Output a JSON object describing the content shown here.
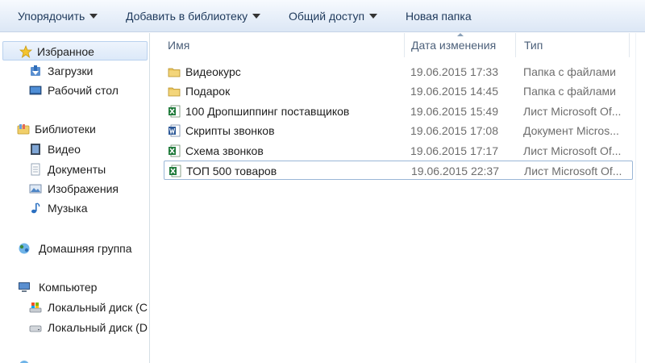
{
  "toolbar": {
    "organize": "Упорядочить",
    "add_to_library": "Добавить в библиотеку",
    "share": "Общий доступ",
    "new_folder": "Новая папка"
  },
  "nav": {
    "favorites": "Избранное",
    "downloads": "Загрузки",
    "desktop": "Рабочий стол",
    "libraries": "Библиотеки",
    "video": "Видео",
    "documents": "Документы",
    "pictures": "Изображения",
    "music": "Музыка",
    "homegroup": "Домашняя группа",
    "computer": "Компьютер",
    "disk_c": "Локальный диск (C",
    "disk_d": "Локальный диск (D"
  },
  "columns": {
    "name": "Имя",
    "date": "Дата изменения",
    "type": "Тип"
  },
  "files": [
    {
      "name": "Видеокурс",
      "date": "19.06.2015 17:33",
      "type": "Папка с файлами",
      "icon": "folder-icon"
    },
    {
      "name": "Подарок",
      "date": "19.06.2015 14:45",
      "type": "Папка с файлами",
      "icon": "folder-icon"
    },
    {
      "name": "100 Дропшиппинг поставщиков",
      "date": "19.06.2015 15:49",
      "type": "Лист Microsoft Of...",
      "icon": "excel-file-icon"
    },
    {
      "name": "Скрипты звонков",
      "date": "19.06.2015 17:08",
      "type": "Документ Micros...",
      "icon": "word-file-icon"
    },
    {
      "name": "Схема звонков",
      "date": "19.06.2015 17:17",
      "type": "Лист Microsoft Of...",
      "icon": "excel-file-icon"
    },
    {
      "name": "ТОП 500 товаров",
      "date": "19.06.2015 22:37",
      "type": "Лист Microsoft Of...",
      "icon": "excel-file-icon"
    }
  ],
  "colors": {
    "toolbar_text": "#1e395b",
    "folder": "#e8c25a",
    "excel": "#1f7a3a",
    "word": "#2b5797",
    "selection_border": "#9ab7d7"
  }
}
